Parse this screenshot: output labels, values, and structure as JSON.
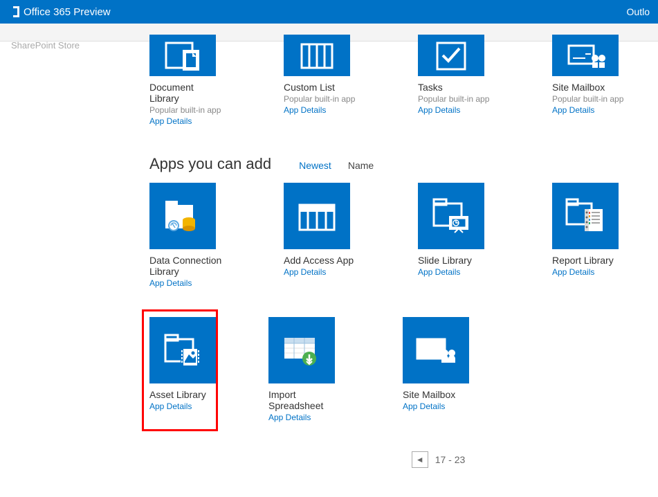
{
  "header": {
    "title": "Office 365 Preview",
    "right_nav": "Outlo"
  },
  "sidebar": {
    "item": "SharePoint Store"
  },
  "sections": {
    "top_apps": [
      {
        "title": "Document Library",
        "subtitle": "Popular built-in app",
        "link": "App Details"
      },
      {
        "title": "Custom List",
        "subtitle": "Popular built-in app",
        "link": "App Details"
      },
      {
        "title": "Tasks",
        "subtitle": "Popular built-in app",
        "link": "App Details"
      },
      {
        "title": "Site Mailbox",
        "subtitle": "Popular built-in app",
        "link": "App Details"
      }
    ],
    "apps_section": {
      "title": "Apps you can add",
      "sort": {
        "newest": "Newest",
        "name": "Name"
      }
    },
    "row1": [
      {
        "title": "Data Connection Library",
        "link": "App Details"
      },
      {
        "title": "Add Access App",
        "link": "App Details"
      },
      {
        "title": "Slide Library",
        "link": "App Details"
      },
      {
        "title": "Report Library",
        "link": "App Details"
      }
    ],
    "row2": [
      {
        "title": "Asset Library",
        "link": "App Details",
        "highlighted": true
      },
      {
        "title": "Import Spreadsheet",
        "link": "App Details"
      },
      {
        "title": "Site Mailbox",
        "link": "App Details"
      }
    ]
  },
  "pagination": {
    "range": "17 - 23",
    "prev_glyph": "◄"
  }
}
